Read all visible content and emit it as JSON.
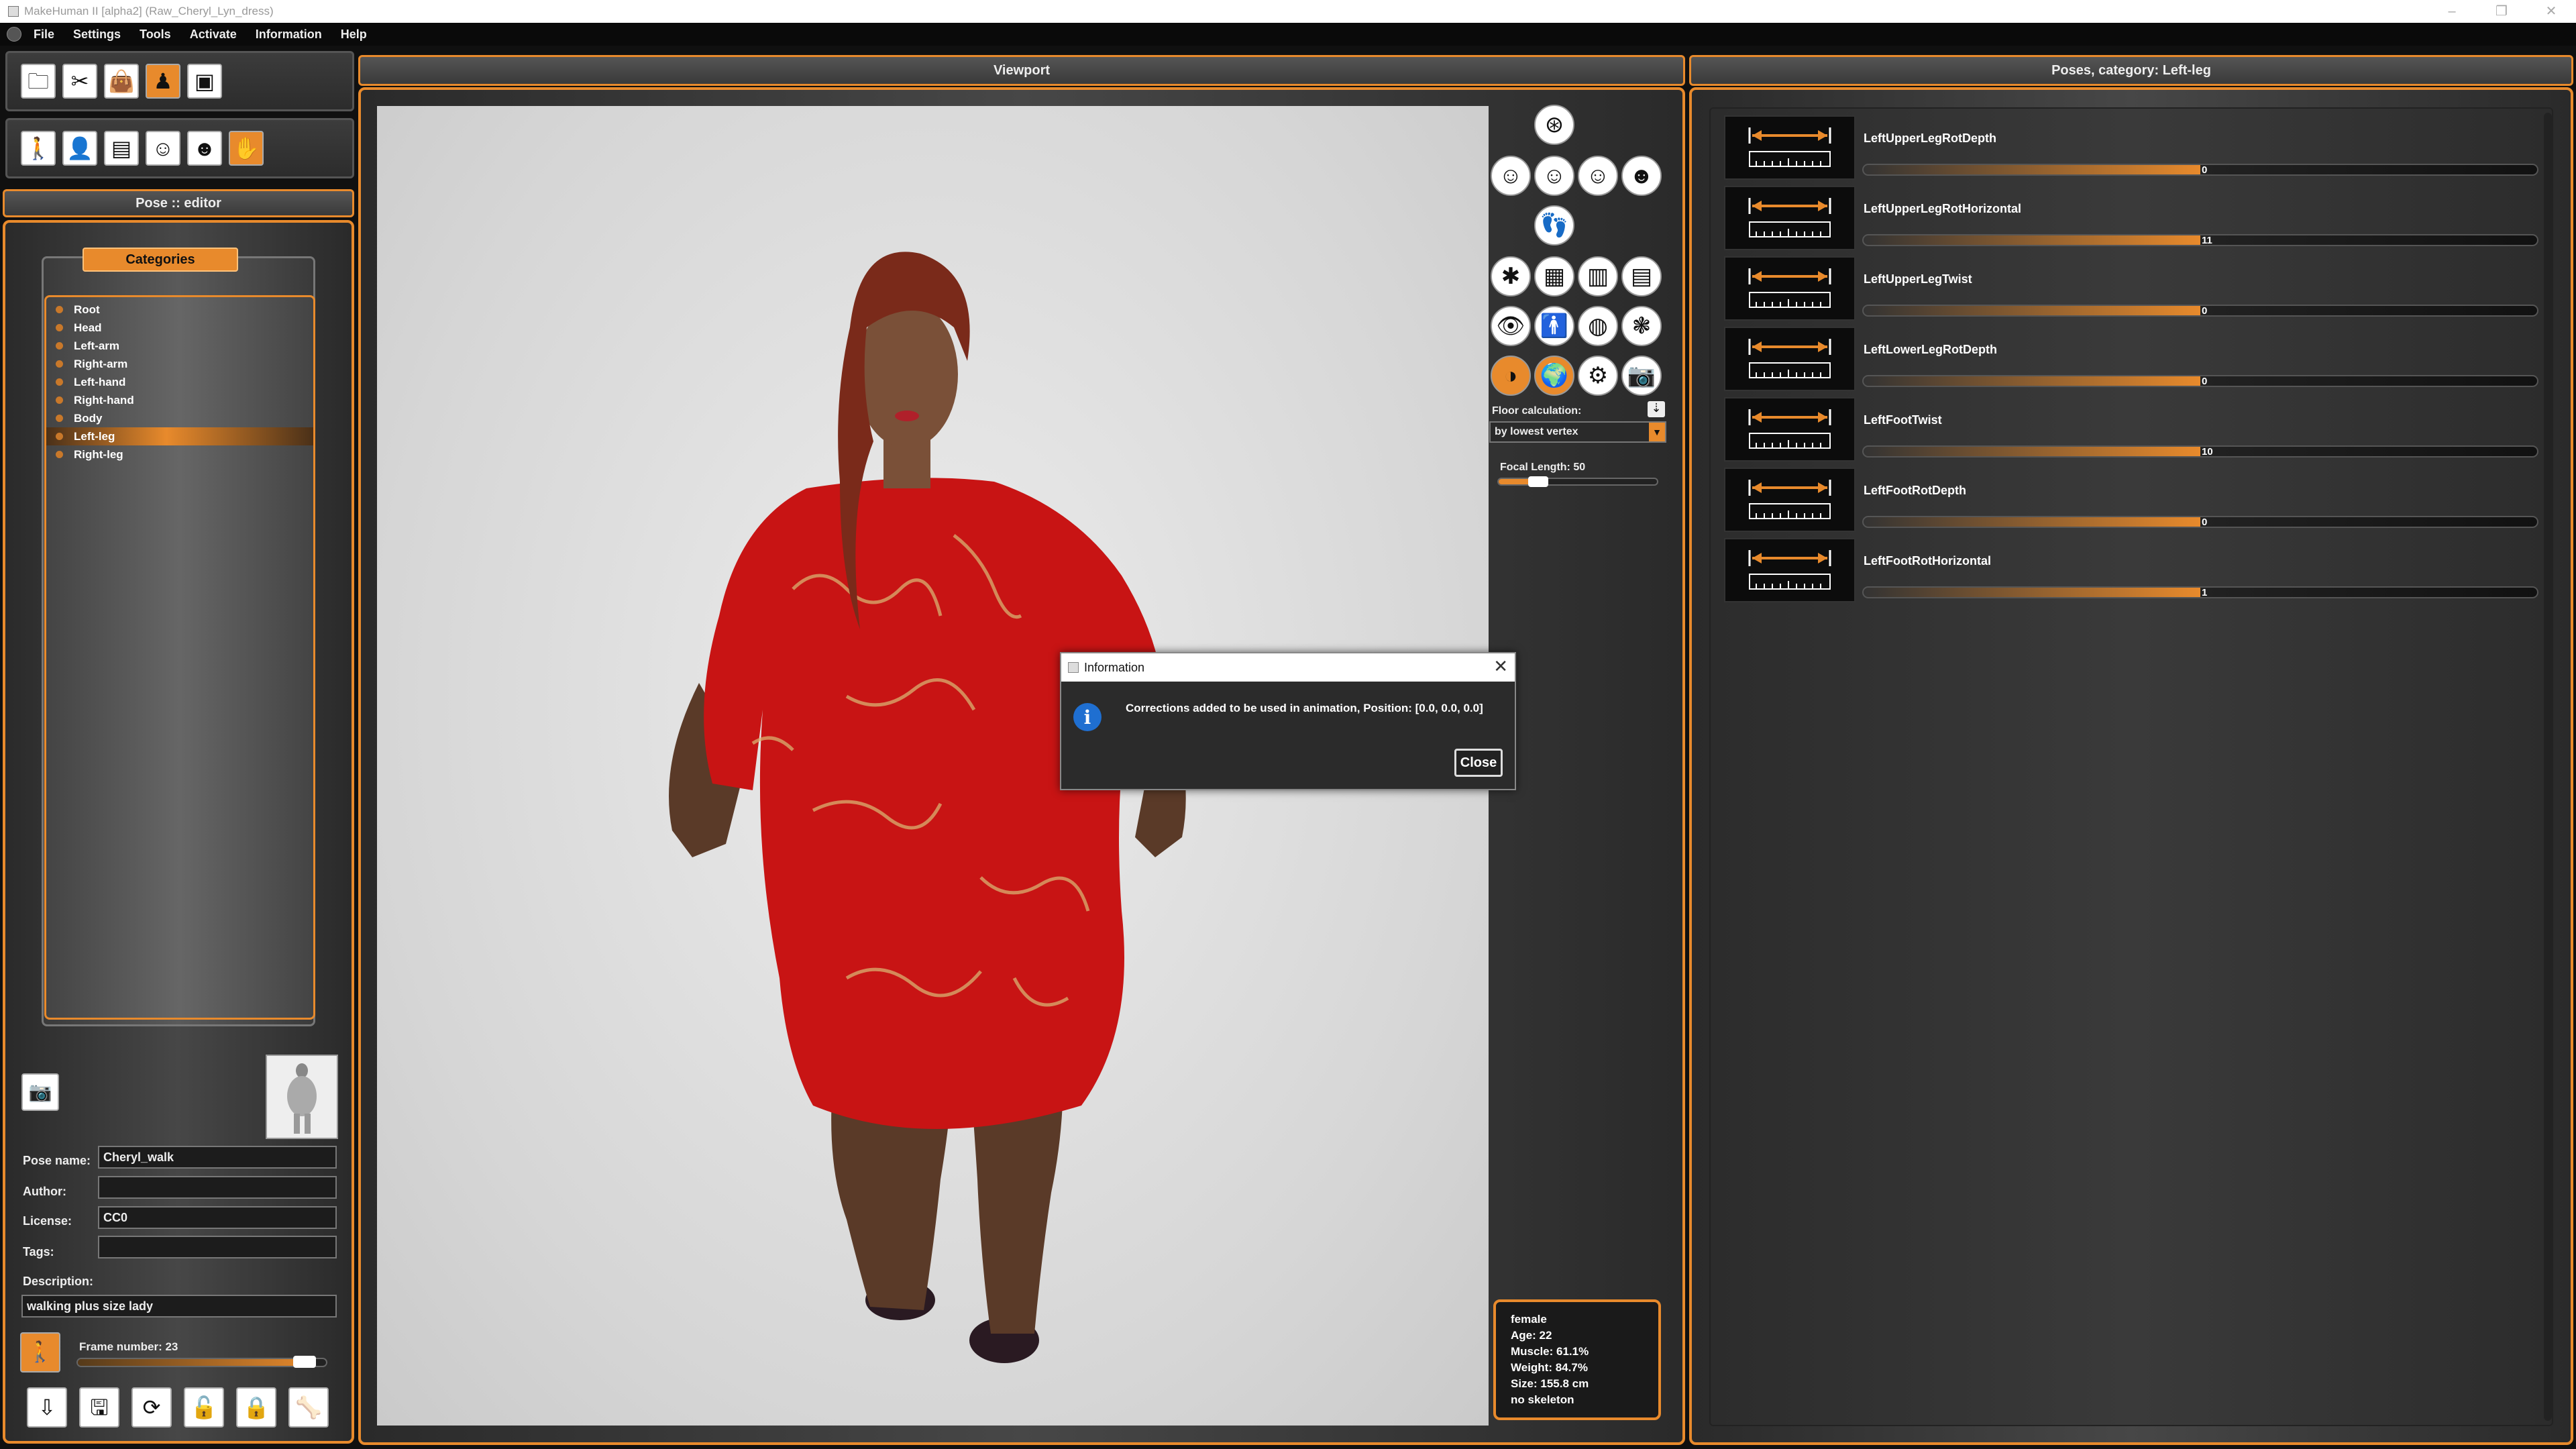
{
  "window": {
    "title": "MakeHuman II [alpha2]  (Raw_Cheryl_Lyn_dress)",
    "minimize": "–",
    "maximize": "❐",
    "close": "✕"
  },
  "menu": [
    "File",
    "Settings",
    "Tools",
    "Activate",
    "Information",
    "Help"
  ],
  "toolbar1_icons": [
    "open-file-icon",
    "modifier-icon",
    "equipment-icon",
    "characters-icon",
    "render-icon"
  ],
  "toolbar2_icons": [
    "human-icon",
    "figure-icon",
    "film-icon",
    "mask-icon",
    "expression-icon",
    "pose-icon"
  ],
  "left": {
    "header": "Pose :: editor",
    "categories_button": "Categories",
    "categories": [
      "Root",
      "Head",
      "Left-arm",
      "Right-arm",
      "Left-hand",
      "Right-hand",
      "Body",
      "Left-leg",
      "Right-leg"
    ],
    "selected_category": "Left-leg",
    "pose_name_label": "Pose name:",
    "pose_name": "Cheryl_walk",
    "author_label": "Author:",
    "author": "",
    "license_label": "License:",
    "license": "CC0",
    "tags_label": "Tags:",
    "tags": "",
    "description_label": "Description:",
    "description": "walking plus size lady",
    "frame_label": "Frame number: 23",
    "frame_fraction": 0.96,
    "bottom_icons": [
      "load-icon",
      "save-icon",
      "rotate-icon",
      "unlock-icon",
      "lock-icon",
      "bone-icon"
    ]
  },
  "viewport": {
    "header": "Viewport",
    "floor_label": "Floor calculation:",
    "floor_value": "by lowest vertex",
    "focal_label": "Focal Length: 50",
    "focal_fraction": 0.25,
    "stats": {
      "gender": "female",
      "age": "Age: 22",
      "muscle": "Muscle: 61.1%",
      "weight": "Weight: 84.7%",
      "size": "Size: 155.8 cm",
      "skeleton": "no skeleton"
    }
  },
  "dialog": {
    "title": "Information",
    "message": "Corrections added to be used in animation, Position: [0.0, 0.0, 0.0]",
    "close_label": "Close"
  },
  "right": {
    "header": "Poses, category: Left-leg",
    "poses": [
      {
        "name": "LeftUpperLegRotDepth",
        "value": "0"
      },
      {
        "name": "LeftUpperLegRotHorizontal",
        "value": "11"
      },
      {
        "name": "LeftUpperLegTwist",
        "value": "0"
      },
      {
        "name": "LeftLowerLegRotDepth",
        "value": "0"
      },
      {
        "name": "LeftFootTwist",
        "value": "10"
      },
      {
        "name": "LeftFootRotDepth",
        "value": "0"
      },
      {
        "name": "LeftFootRotHorizontal",
        "value": "1"
      }
    ]
  },
  "colors": {
    "accent": "#e88a2c",
    "dress": "#c81414",
    "background": "#101010"
  }
}
